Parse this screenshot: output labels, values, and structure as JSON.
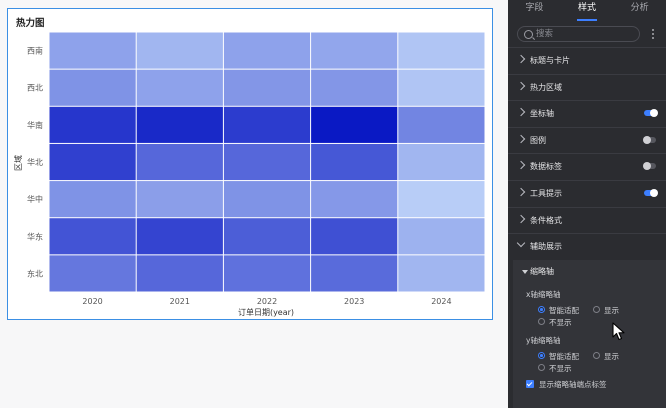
{
  "chart": {
    "title": "热力图",
    "xlabel": "订单日期(year)",
    "ylabel": "区域"
  },
  "chart_data": {
    "type": "heatmap",
    "title": "热力图",
    "xlabel": "订单日期(year)",
    "ylabel": "区域",
    "x": [
      "2020",
      "2021",
      "2022",
      "2023",
      "2024"
    ],
    "y": [
      "西南",
      "西北",
      "华南",
      "华北",
      "华中",
      "华东",
      "东北"
    ],
    "values": [
      [
        0.3,
        0.2,
        0.3,
        0.28,
        0.12
      ],
      [
        0.38,
        0.3,
        0.36,
        0.36,
        0.12
      ],
      [
        0.85,
        0.92,
        0.82,
        1.0,
        0.45
      ],
      [
        0.8,
        0.6,
        0.6,
        0.68,
        0.2
      ],
      [
        0.38,
        0.32,
        0.38,
        0.35,
        0.08
      ],
      [
        0.7,
        0.78,
        0.65,
        0.72,
        0.22
      ],
      [
        0.52,
        0.6,
        0.55,
        0.58,
        0.2
      ]
    ],
    "color_low": "#c7ddfb",
    "color_high": "#0a19c4"
  },
  "panel": {
    "tabs": [
      {
        "label": "字段",
        "active": false
      },
      {
        "label": "样式",
        "active": true
      },
      {
        "label": "分析",
        "active": false
      }
    ],
    "search": {
      "placeholder": "搜索"
    },
    "sections": [
      {
        "label": "标题与卡片",
        "toggle": null,
        "expanded": false
      },
      {
        "label": "热力区域",
        "toggle": null,
        "expanded": false
      },
      {
        "label": "坐标轴",
        "toggle": "on",
        "expanded": false
      },
      {
        "label": "图例",
        "toggle": "off",
        "expanded": false
      },
      {
        "label": "数据标签",
        "toggle": "off",
        "expanded": false
      },
      {
        "label": "工具提示",
        "toggle": "on",
        "expanded": false
      },
      {
        "label": "条件格式",
        "toggle": null,
        "expanded": false
      },
      {
        "label": "辅助展示",
        "toggle": null,
        "expanded": true
      }
    ],
    "sub": {
      "title": "缩略轴",
      "x_axis": {
        "label": "x轴缩略轴",
        "options": [
          "智能适配",
          "显示",
          "不显示"
        ],
        "selected": "智能适配"
      },
      "y_axis": {
        "label": "y轴缩略轴",
        "options": [
          "智能适配",
          "显示",
          "不显示"
        ],
        "selected": "智能适配"
      },
      "checkbox": {
        "label": "显示缩略轴端点标签",
        "checked": true
      }
    }
  },
  "colors": {
    "accent": "#3d7fff",
    "panel_bg": "#2b2c30",
    "card_border": "#3b8fe4"
  }
}
